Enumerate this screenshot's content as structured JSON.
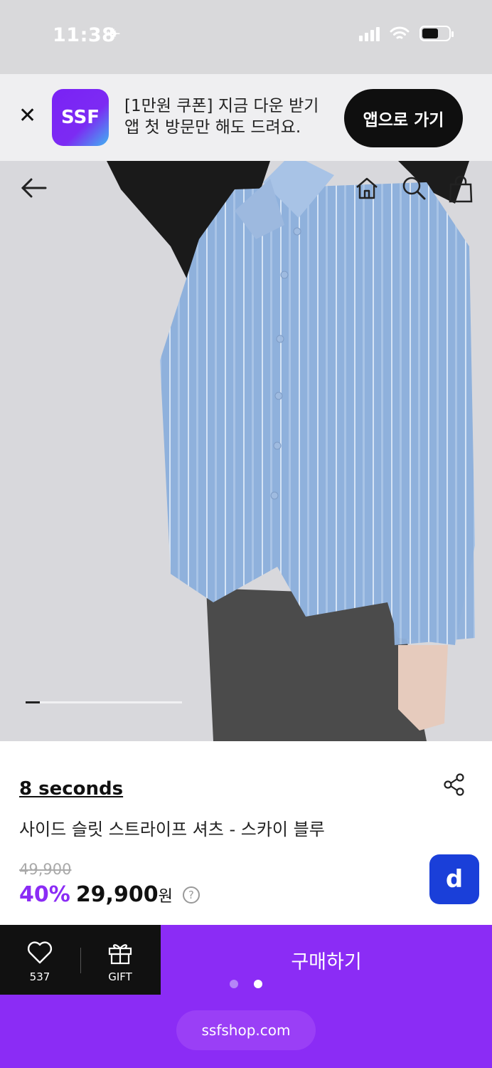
{
  "status_bar": {
    "time": "11:38"
  },
  "app_banner": {
    "logo_text": "SSF",
    "line1": "[1만원 쿠폰] 지금 다운 받기",
    "line2": "앱 첫 방문만 해도 드려요.",
    "cta": "앱으로 가기"
  },
  "image_nav": {
    "icons": [
      "back-arrow-icon",
      "home-icon",
      "search-icon",
      "shopping-bag-icon"
    ]
  },
  "image_gallery": {
    "progress_fraction": 0.09
  },
  "product": {
    "brand": "8 seconds",
    "name": "사이드 슬릿 스트라이프 셔츠 - 스카이 블루",
    "original_price": "49,900",
    "discount": "40%",
    "sale_price": "29,900",
    "currency": "원",
    "badge": "d"
  },
  "bottom_bar": {
    "like_count": "537",
    "gift_label": "GIFT",
    "buy_label": "구매하기"
  },
  "footer": {
    "url": "ssfshop.com"
  },
  "colors": {
    "accent": "#8b2cf5",
    "banner_cta": "#0f0f0f",
    "badge": "#1a3fd9"
  }
}
